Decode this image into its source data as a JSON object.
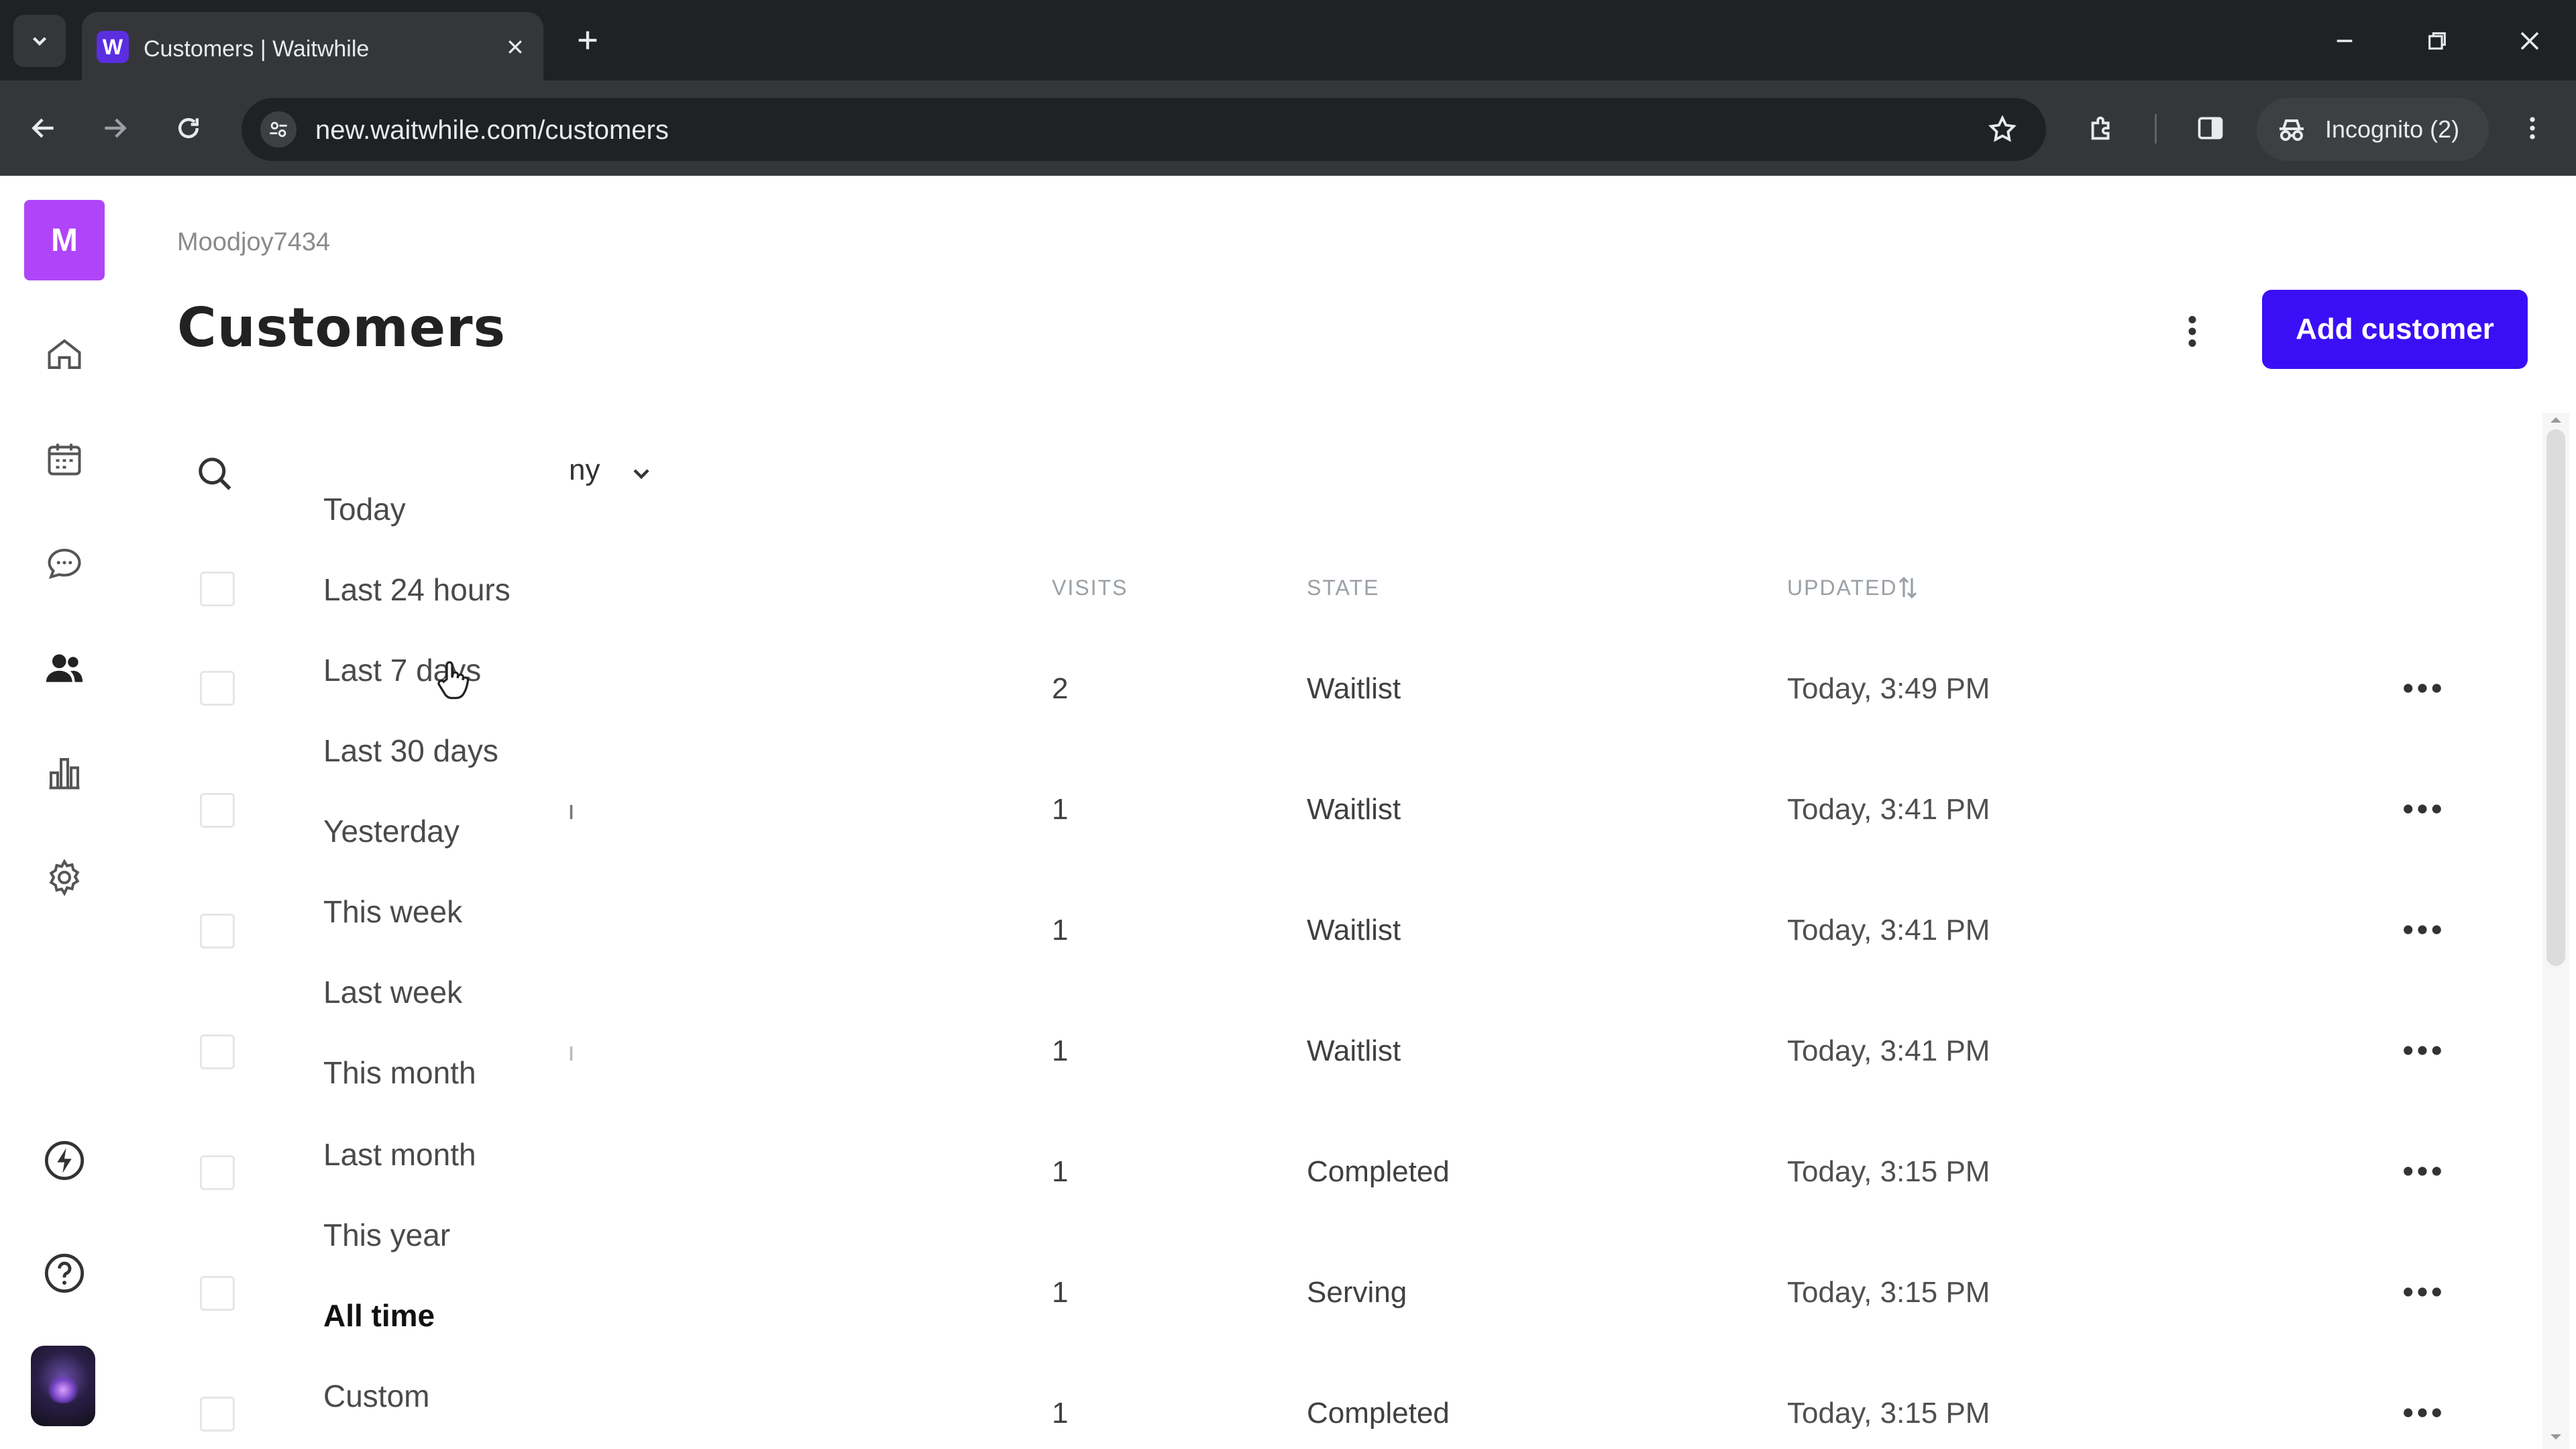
{
  "browser": {
    "tab_title": "Customers | Waitwhile",
    "favicon_letter": "W",
    "url": "new.waitwhile.com/customers",
    "incognito_label": "Incognito (2)"
  },
  "sidebar": {
    "org_initial": "M",
    "items": [
      {
        "name": "home",
        "icon": "home-icon"
      },
      {
        "name": "calendar",
        "icon": "calendar-icon"
      },
      {
        "name": "messages",
        "icon": "chat-icon"
      },
      {
        "name": "customers",
        "icon": "users-icon",
        "active": true
      },
      {
        "name": "analytics",
        "icon": "bar-chart-icon"
      },
      {
        "name": "settings",
        "icon": "gear-icon"
      },
      {
        "name": "whats-new",
        "icon": "lightning-icon"
      },
      {
        "name": "help",
        "icon": "help-icon"
      }
    ]
  },
  "header": {
    "org_name": "Moodjoy7434",
    "title": "Customers",
    "add_button": "Add customer"
  },
  "filter": {
    "visible_text": "ny"
  },
  "dropdown": {
    "options": [
      "Today",
      "Last 24 hours",
      "Last 7 days",
      "Last 30 days",
      "Yesterday",
      "This week",
      "Last week",
      "This month",
      "Last month",
      "This year",
      "All time",
      "Custom"
    ],
    "selected": "All time"
  },
  "table": {
    "columns": {
      "visits": "VISITS",
      "state": "STATE",
      "updated": "UPDATED"
    },
    "rows": [
      {
        "visits": "2",
        "state": "Waitlist",
        "updated": "Today, 3:49 PM"
      },
      {
        "visits": "1",
        "state": "Waitlist",
        "updated": "Today, 3:41 PM"
      },
      {
        "visits": "1",
        "state": "Waitlist",
        "updated": "Today, 3:41 PM"
      },
      {
        "visits": "1",
        "state": "Waitlist",
        "updated": "Today, 3:41 PM"
      },
      {
        "visits": "1",
        "state": "Completed",
        "updated": "Today, 3:15 PM"
      },
      {
        "visits": "1",
        "state": "Serving",
        "updated": "Today, 3:15 PM"
      },
      {
        "visits": "1",
        "state": "Completed",
        "updated": "Today, 3:15 PM"
      }
    ]
  },
  "colors": {
    "accent": "#3b0ff5",
    "org_avatar": "#b044f8",
    "chrome_dark": "#202124",
    "chrome_toolbar": "#35363a"
  }
}
